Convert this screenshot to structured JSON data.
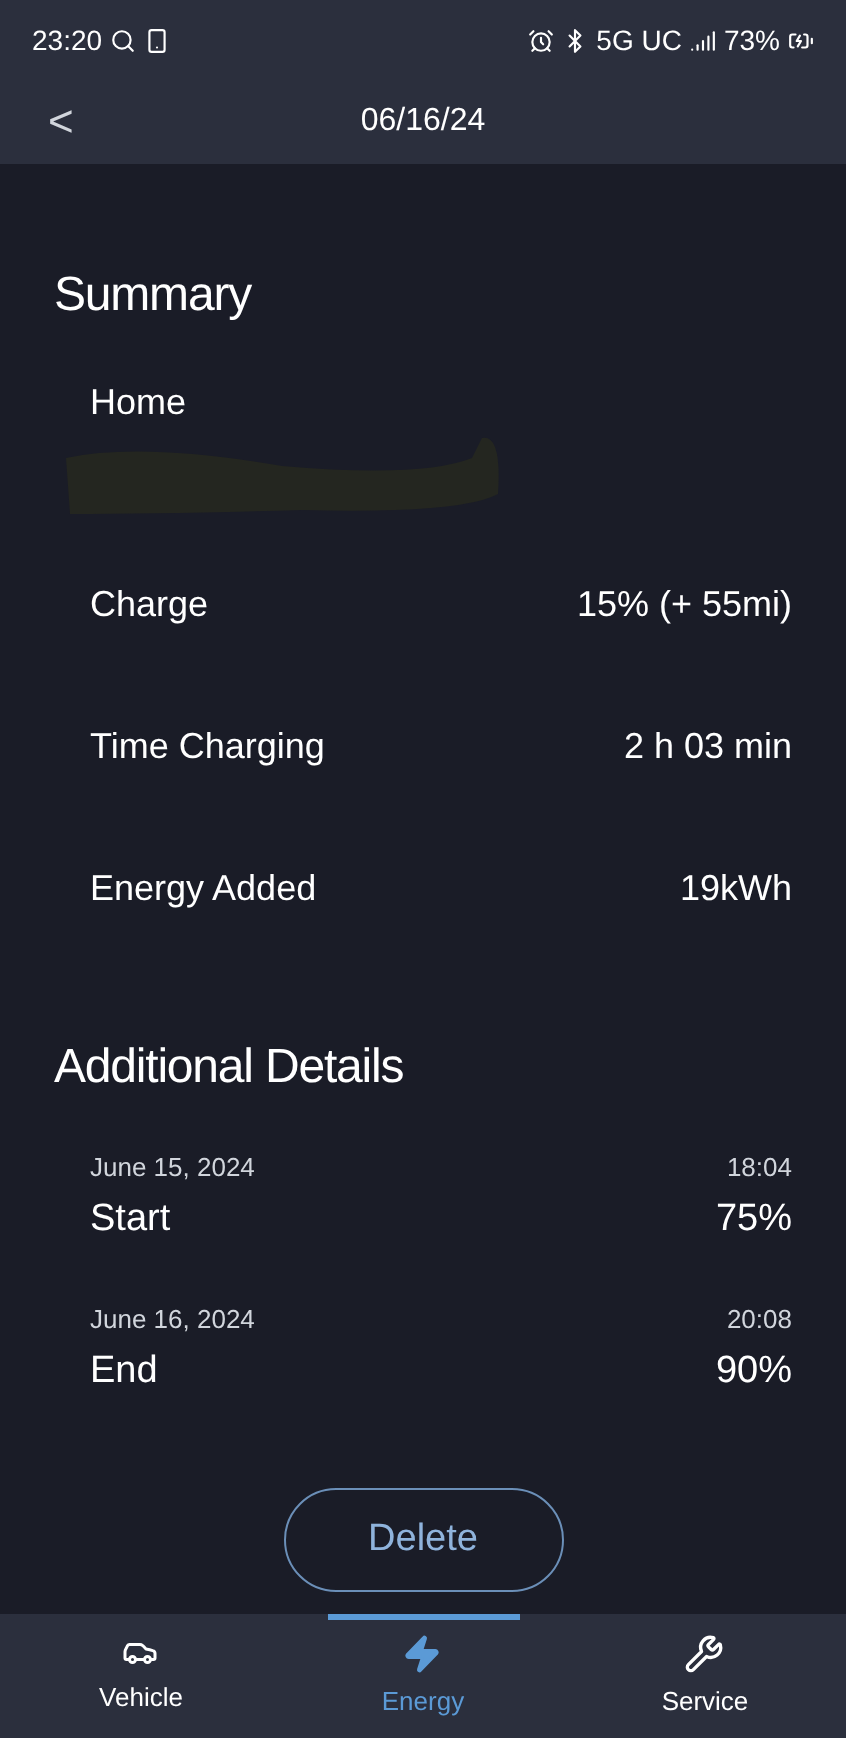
{
  "status_bar": {
    "time": "23:20",
    "network": "5G UC",
    "battery": "73%"
  },
  "header": {
    "back": "<",
    "title": "06/16/24"
  },
  "summary": {
    "title": "Summary",
    "location": "Home",
    "rows": [
      {
        "label": "Charge",
        "value": "15% (+ 55mi)"
      },
      {
        "label": "Time Charging",
        "value": "2 h 03 min"
      },
      {
        "label": "Energy Added",
        "value": "19kWh"
      }
    ]
  },
  "details": {
    "title": "Additional Details",
    "rows": [
      {
        "date": "June 15, 2024",
        "time": "18:04",
        "label": "Start",
        "value": "75%"
      },
      {
        "date": "June 16, 2024",
        "time": "20:08",
        "label": "End",
        "value": "90%"
      }
    ]
  },
  "delete_button": "Delete",
  "nav": [
    {
      "label": "Vehicle",
      "kind": "car",
      "selected": false
    },
    {
      "label": "Energy",
      "kind": "bolt",
      "selected": true
    },
    {
      "label": "Service",
      "kind": "tools",
      "selected": false
    }
  ]
}
